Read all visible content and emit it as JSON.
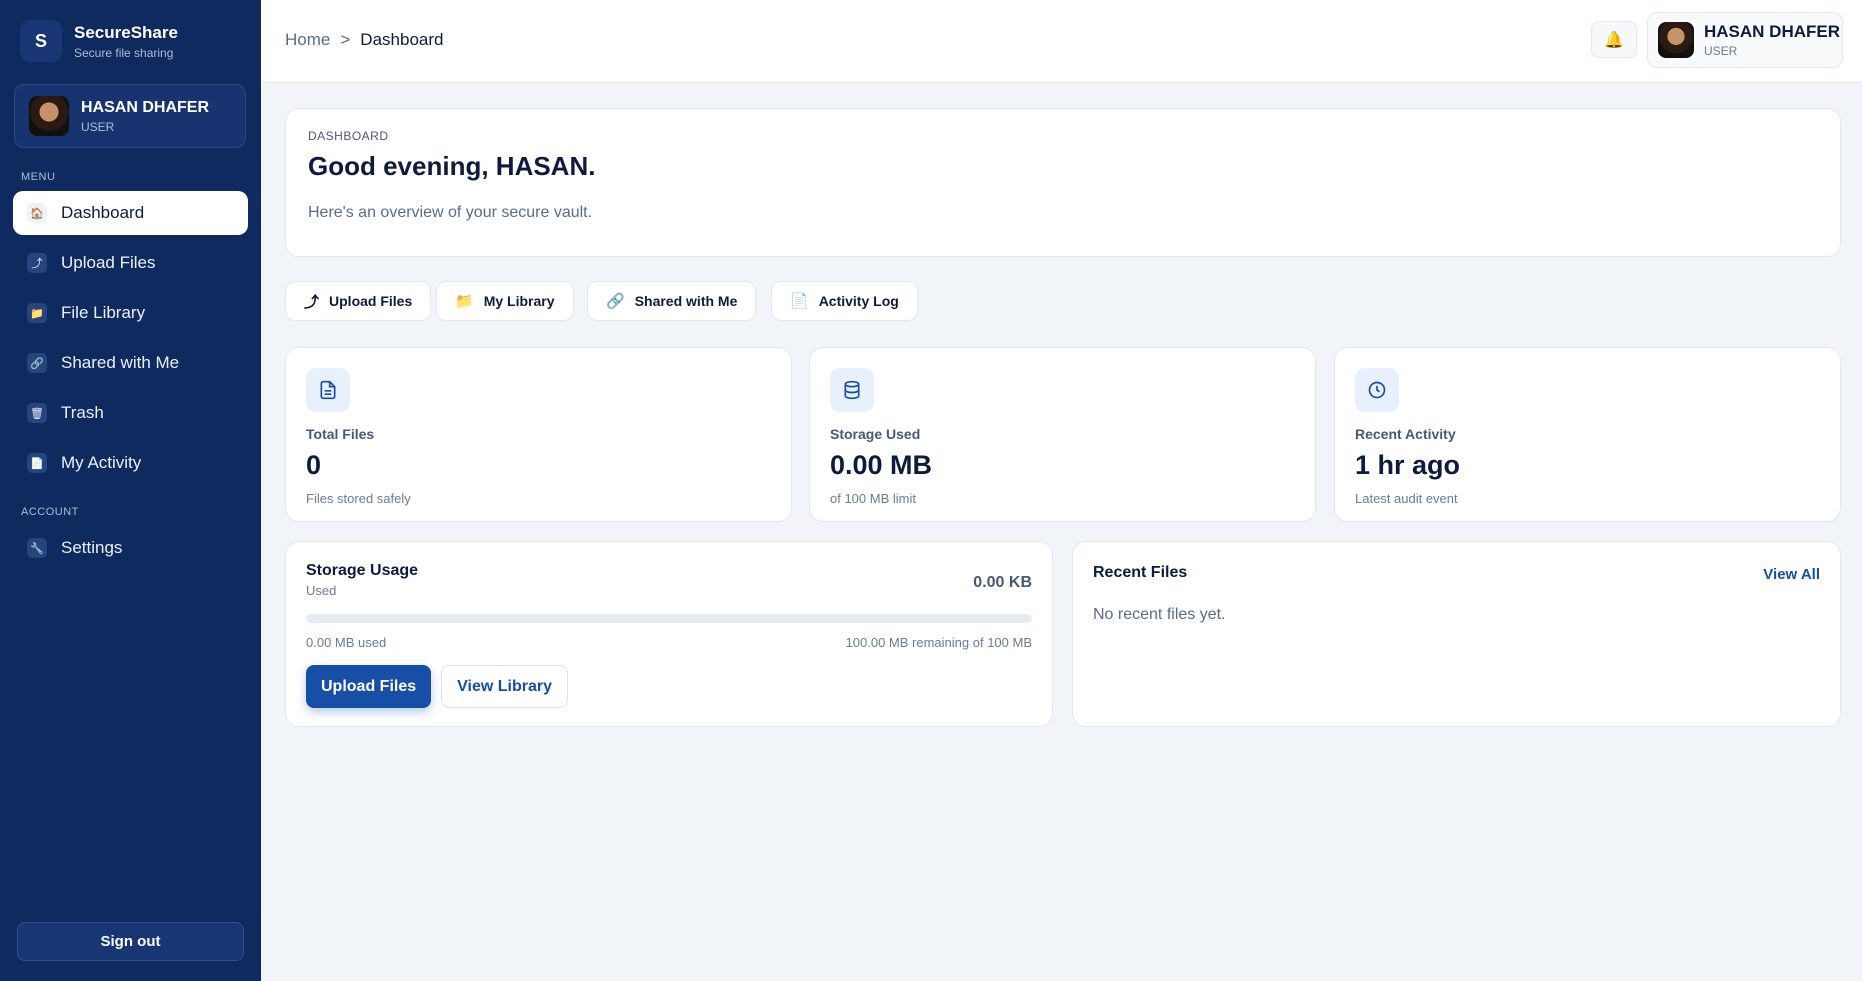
{
  "brand": {
    "logo_letter": "S",
    "name": "SecureShare",
    "tagline": "Secure file sharing"
  },
  "user": {
    "name": "HASAN DHAFER",
    "role": "USER"
  },
  "sidebar": {
    "menu_label": "MENU",
    "items": [
      {
        "label": "Dashboard",
        "icon": "home-icon",
        "glyph": "🏠"
      },
      {
        "label": "Upload Files",
        "icon": "upload-icon",
        "glyph": "⤴"
      },
      {
        "label": "File Library",
        "icon": "folder-icon",
        "glyph": "📁"
      },
      {
        "label": "Shared with Me",
        "icon": "link-icon",
        "glyph": "🔗"
      },
      {
        "label": "Trash",
        "icon": "trash-icon",
        "glyph": "🗑"
      },
      {
        "label": "My Activity",
        "icon": "activity-icon",
        "glyph": "📄"
      }
    ],
    "account_label": "ACCOUNT",
    "account_items": [
      {
        "label": "Settings",
        "icon": "wrench-icon",
        "glyph": "🔧"
      }
    ],
    "signout_label": "Sign out"
  },
  "header": {
    "breadcrumb_home": "Home",
    "breadcrumb_sep": ">",
    "breadcrumb_current": "Dashboard",
    "bell_icon": "bell-icon"
  },
  "hero": {
    "eyebrow": "DASHBOARD",
    "greeting": "Good evening, HASAN.",
    "subtitle": "Here's an overview of your secure vault."
  },
  "quick_actions": [
    {
      "label": "Upload Files",
      "icon": "upload-icon",
      "glyph": "⤴"
    },
    {
      "label": "My Library",
      "icon": "folder-icon",
      "glyph": "📁"
    },
    {
      "label": "Shared with Me",
      "icon": "link-icon",
      "glyph": "🔗"
    },
    {
      "label": "Activity Log",
      "icon": "document-icon",
      "glyph": "📄"
    }
  ],
  "stats": [
    {
      "label": "Total Files",
      "value": "0",
      "note": "Files stored safely",
      "icon": "file-icon"
    },
    {
      "label": "Storage Used",
      "value": "0.00 MB",
      "note": "of 100 MB limit",
      "icon": "database-icon"
    },
    {
      "label": "Recent Activity",
      "value": "1 hr ago",
      "note": "Latest audit event",
      "icon": "clock-icon"
    }
  ],
  "storage": {
    "title": "Storage Usage",
    "subtitle": "Used",
    "amount": "0.00 KB",
    "progress_fraction": 0.0,
    "used_text": "0.00 MB used",
    "remaining_text": "100.00 MB remaining of 100 MB",
    "upload_label": "Upload Files",
    "view_label": "View Library"
  },
  "recent_files": {
    "title": "Recent Files",
    "view_all": "View All",
    "empty": "No recent files yet."
  },
  "colors": {
    "sidebar": "#0f2a5f",
    "accent": "#174ea6",
    "background": "#f1f4f9"
  }
}
